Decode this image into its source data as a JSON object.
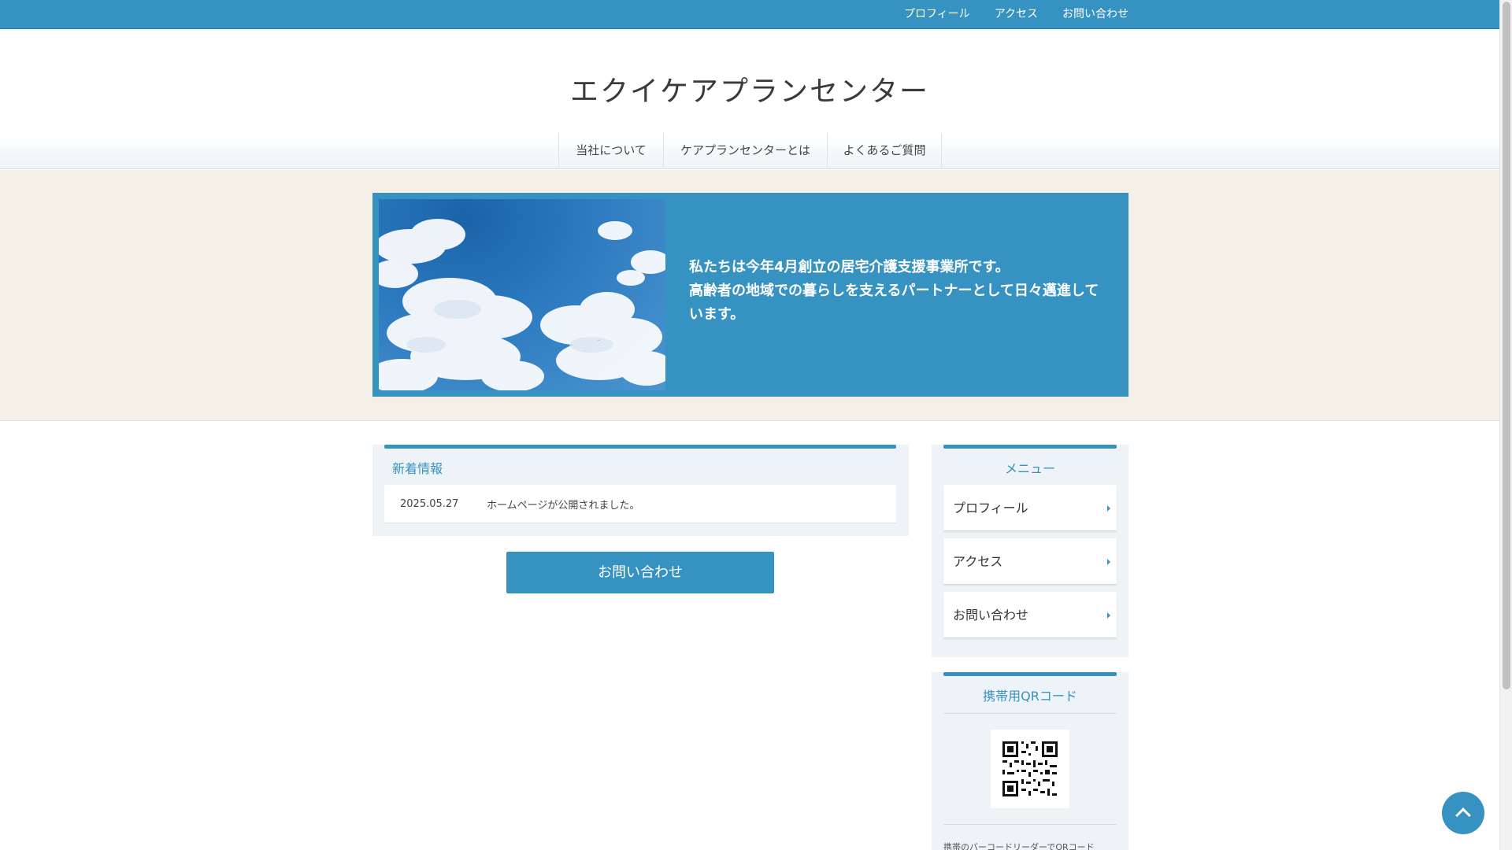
{
  "topbar": {
    "links": [
      "プロフィール",
      "アクセス",
      "お問い合わせ"
    ]
  },
  "header": {
    "site_title": "エクイケアプランセンター",
    "nav": [
      "当社について",
      "ケアプランセンターとは",
      "よくあるご質問"
    ]
  },
  "hero": {
    "text_line1": "私たちは今年4月創立の居宅介護支援事業所です。",
    "text_line2": "高齢者の地域での暮らしを支えるパートナーとして日々邁進しています。"
  },
  "news": {
    "title": "新着情報",
    "items": [
      {
        "date": "2025.05.27",
        "text": "ホームページが公開されました。"
      }
    ]
  },
  "contact_button": "お問い合わせ",
  "sidebar": {
    "menu_title": "メニュー",
    "menu_items": [
      "プロフィール",
      "アクセス",
      "お問い合わせ"
    ],
    "qr_title": "携帯用QRコード",
    "qr_desc": "携帯のバーコードリーダーでQRコード"
  },
  "colors": {
    "accent": "#3692c0",
    "hero_band": "#f4f0e7",
    "panel_bg": "#eef3f8"
  },
  "icons": {
    "menu_arrow": "caret-right-icon",
    "back_to_top": "chevron-up-icon"
  }
}
